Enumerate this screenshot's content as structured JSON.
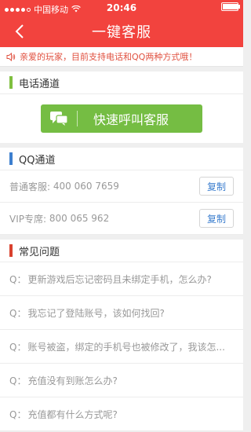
{
  "status_bar": {
    "carrier": "中国移动",
    "time": "20:46",
    "wifi_icon": "wifi-icon",
    "battery_icon": "battery-icon",
    "battery_level": 0.94
  },
  "nav": {
    "back_icon": "chevron-left-icon",
    "title": "一键客服"
  },
  "notice": {
    "icon": "speaker-icon",
    "text": "亲爱的玩家，目前支持电话和QQ两种方式哦！"
  },
  "phone_section": {
    "title": "电话通道",
    "button_label": "快速呼叫客服",
    "button_icon": "chat-icon"
  },
  "qq_section": {
    "title": "QQ通道",
    "rows": [
      {
        "label": "普通客服:",
        "number": "400 060 7659",
        "copy_label": "复制"
      },
      {
        "label": "VIP专席:",
        "number": "800 065 962",
        "copy_label": "复制"
      }
    ]
  },
  "faq_section": {
    "title": "常见问题",
    "prefix": "Q：",
    "items": [
      "更新游戏后忘记密码且未绑定手机，怎么办?",
      "我忘记了登陆账号，该如何找回?",
      "账号被盗，绑定的手机号也被修改了，我该怎...",
      "充值没有到账怎么办?",
      "充值都有什么方式呢?"
    ]
  },
  "colors": {
    "brand_red": "#f2433e",
    "green": "#75bd43",
    "blue": "#3d7fcf",
    "section_red": "#d9412e"
  }
}
